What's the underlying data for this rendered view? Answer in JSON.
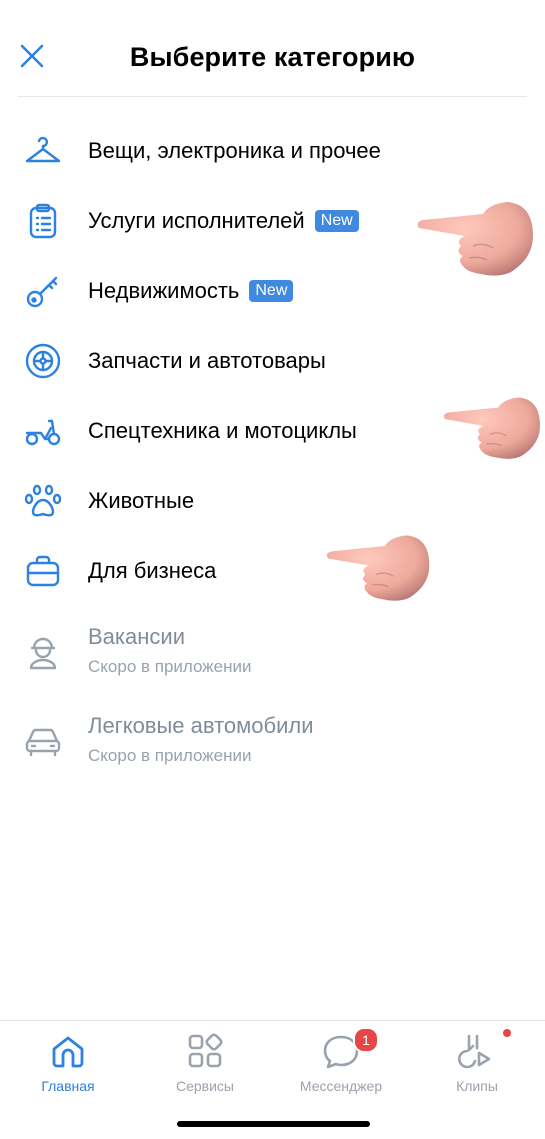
{
  "header": {
    "title": "Выберите категорию",
    "close_icon": "close-icon"
  },
  "categories": [
    {
      "label": "Вещи, электроника и прочее",
      "icon": "hanger-icon"
    },
    {
      "label": "Услуги исполнителей",
      "badge": "New",
      "icon": "clipboard-icon"
    },
    {
      "label": "Недвижимость",
      "badge": "New",
      "icon": "key-icon"
    },
    {
      "label": "Запчасти и автотовары",
      "icon": "wheel-icon"
    },
    {
      "label": "Спецтехника и мотоциклы",
      "icon": "motorcycle-icon"
    },
    {
      "label": "Животные",
      "icon": "paw-icon"
    },
    {
      "label": "Для бизнеса",
      "icon": "briefcase-icon"
    },
    {
      "label": "Вакансии",
      "sublabel": "Скоро в приложении",
      "icon": "worker-icon",
      "disabled": true
    },
    {
      "label": "Легковые автомобили",
      "sublabel": "Скоро в приложении",
      "icon": "car-icon",
      "disabled": true
    }
  ],
  "tabbar": {
    "items": [
      {
        "label": "Главная",
        "icon": "home-icon",
        "active": true
      },
      {
        "label": "Сервисы",
        "icon": "services-icon"
      },
      {
        "label": "Мессенджер",
        "icon": "messenger-icon",
        "counter": "1"
      },
      {
        "label": "Клипы",
        "icon": "clips-icon"
      }
    ]
  },
  "colors": {
    "accent": "#2d81e0",
    "badge": "#3f8ae0",
    "disabled_text": "#818c99",
    "counter": "#e64646"
  }
}
